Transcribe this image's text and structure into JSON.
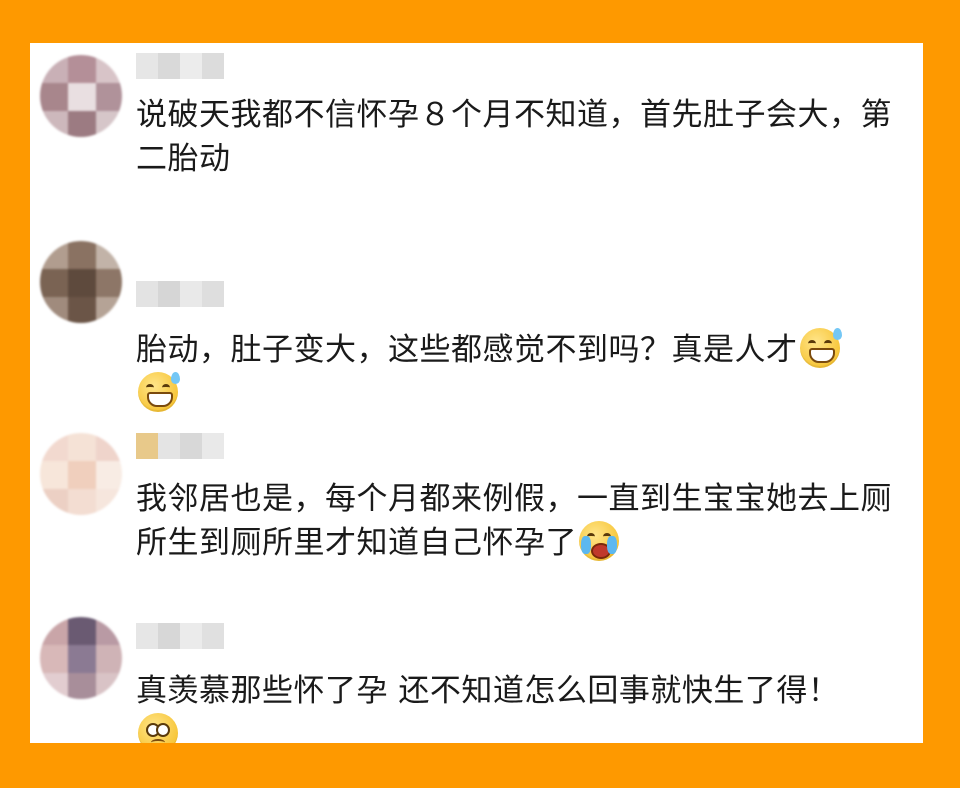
{
  "page": {
    "background_color": "#FE9900",
    "panel_color": "#FFFFFF"
  },
  "comments": [
    {
      "avatar": "blurred-avatar",
      "username": "",
      "text": "说破天我都不信怀孕８个月不知道，首先肚子会大，第二胎动",
      "emojis": []
    },
    {
      "avatar": "blurred-avatar",
      "username": "",
      "text": "胎动，肚子变大，这些都感觉不到吗？真是人才",
      "emojis": [
        "grinning-sweat-emoji",
        "grinning-sweat-emoji"
      ]
    },
    {
      "avatar": "blurred-avatar",
      "username": "",
      "text": "我邻居也是，每个月都来例假，一直到生宝宝她去上厕所生到厕所里才知道自己怀孕了",
      "emojis": [
        "crying-laughing-emoji"
      ]
    },
    {
      "avatar": "blurred-avatar",
      "username": "",
      "text": "真羡慕那些怀了孕 还不知道怎么回事就快生了得！",
      "emojis": [
        "pleading-emoji"
      ]
    }
  ]
}
